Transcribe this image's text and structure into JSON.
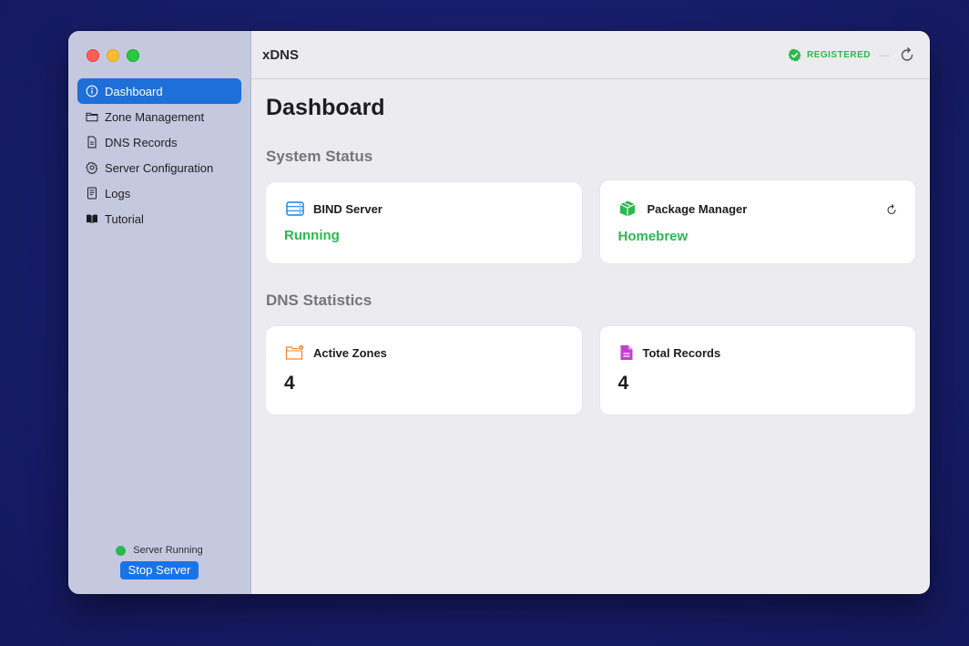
{
  "app": {
    "title": "xDNS"
  },
  "toolbar": {
    "registration": "REGISTERED",
    "separator": "—"
  },
  "sidebar": {
    "items": [
      {
        "label": "Dashboard",
        "icon": "info-circle-icon",
        "active": true
      },
      {
        "label": "Zone Management",
        "icon": "folder-icon",
        "active": false
      },
      {
        "label": "DNS Records",
        "icon": "document-icon",
        "active": false
      },
      {
        "label": "Server Configuration",
        "icon": "gear-icon",
        "active": false
      },
      {
        "label": "Logs",
        "icon": "list-document-icon",
        "active": false
      },
      {
        "label": "Tutorial",
        "icon": "book-icon",
        "active": false
      }
    ],
    "status_text": "Server Running",
    "stop_button": "Stop Server"
  },
  "main": {
    "page_title": "Dashboard",
    "system_status": {
      "title": "System Status",
      "bind": {
        "label": "BIND Server",
        "value": "Running",
        "icon": "server-icon"
      },
      "package": {
        "label": "Package Manager",
        "value": "Homebrew",
        "icon": "package-icon"
      }
    },
    "dns_statistics": {
      "title": "DNS Statistics",
      "zones": {
        "label": "Active Zones",
        "value": "4",
        "icon": "folder-gear-icon"
      },
      "records": {
        "label": "Total Records",
        "value": "4",
        "icon": "document-fill-icon"
      }
    }
  },
  "colors": {
    "accent": "#1e6fd9",
    "success": "#2db84d",
    "orange": "#f0892b",
    "magenta": "#c43fd1",
    "server_blue": "#1a7fe0"
  }
}
